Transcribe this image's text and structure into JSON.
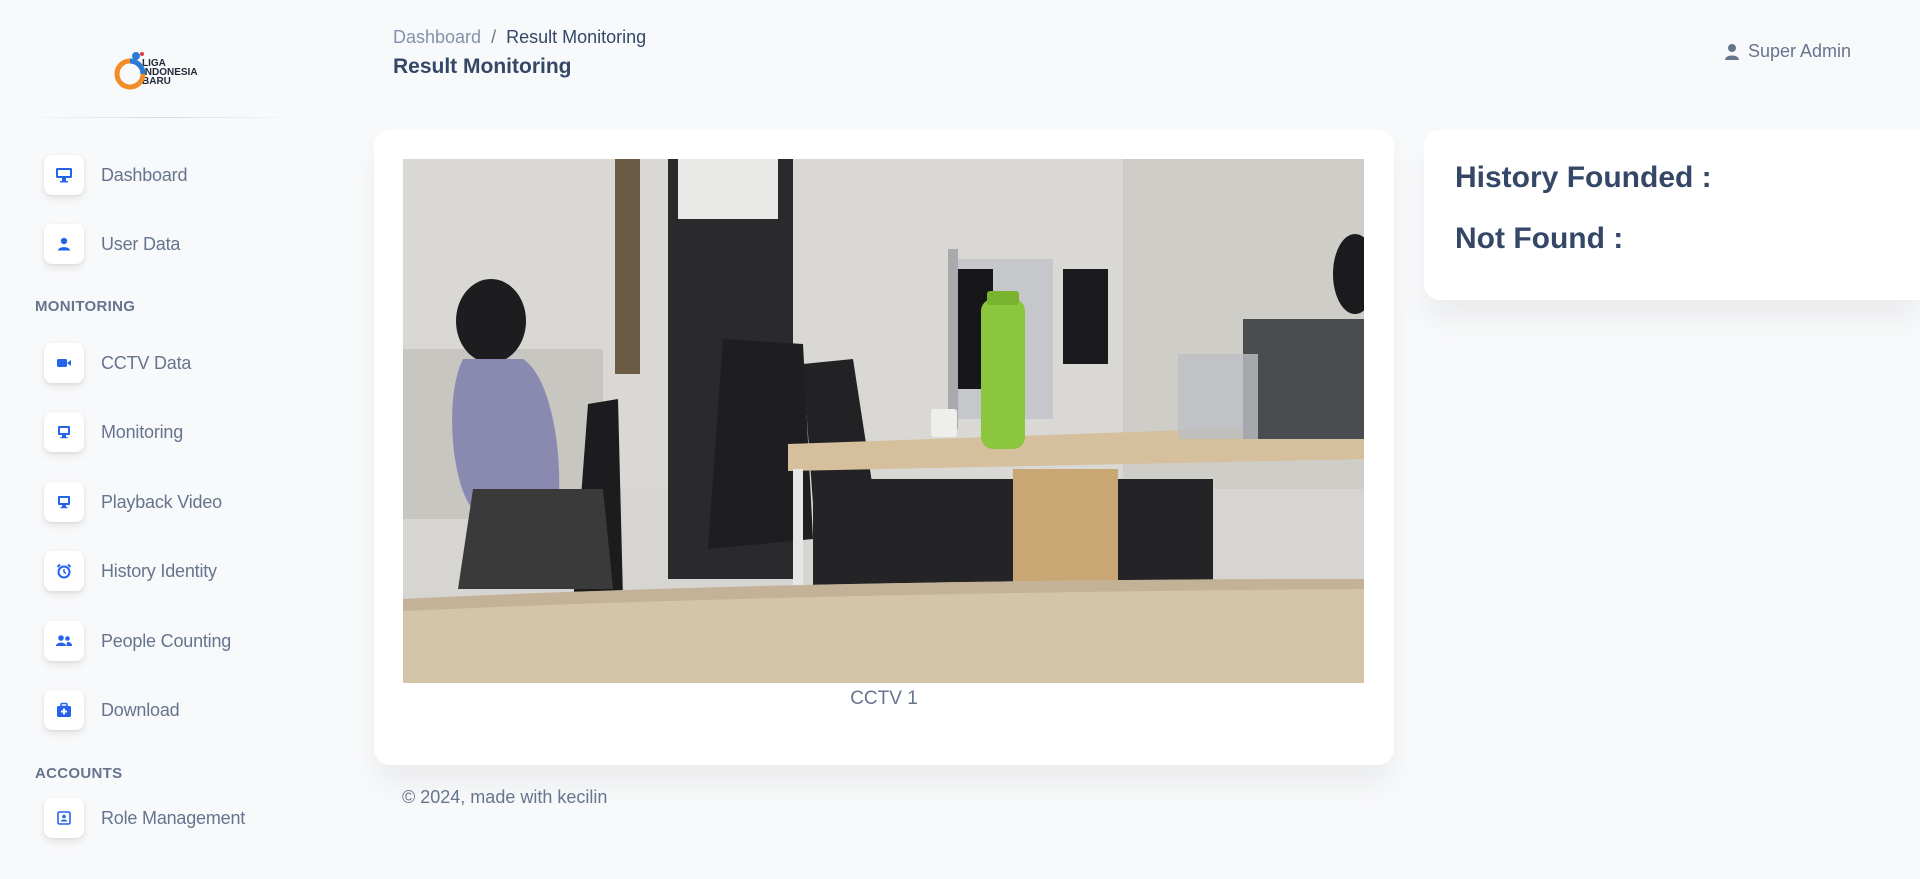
{
  "logo": {
    "lines": [
      "LIGA",
      "INDONESIA",
      "BARU"
    ]
  },
  "sidebar": {
    "items": [
      {
        "label": "Dashboard",
        "icon": "monitor-icon"
      },
      {
        "label": "User Data",
        "icon": "user-icon"
      }
    ],
    "monitoring_heading": "MONITORING",
    "monitoring_items": [
      {
        "label": "CCTV Data",
        "icon": "video-camera-icon"
      },
      {
        "label": "Monitoring",
        "icon": "monitor-icon"
      },
      {
        "label": "Playback Video",
        "icon": "monitor-icon"
      },
      {
        "label": "History Identity",
        "icon": "alarm-clock-icon"
      },
      {
        "label": "People Counting",
        "icon": "users-icon"
      },
      {
        "label": "Download",
        "icon": "briefcase-medical-icon"
      }
    ],
    "accounts_heading": "ACCOUNTS",
    "accounts_items": [
      {
        "label": "Role Management",
        "icon": "id-card-icon"
      }
    ]
  },
  "header": {
    "breadcrumb_parent": "Dashboard",
    "breadcrumb_separator": "/",
    "breadcrumb_current": "Result Monitoring",
    "title": "Result Monitoring",
    "user_name": "Super Admin"
  },
  "main": {
    "camera_label": "CCTV 1"
  },
  "side_panel": {
    "history_founded": "History Founded :",
    "not_found": "Not Found :"
  },
  "footer": {
    "text": "© 2024, made with kecilin"
  },
  "colors": {
    "accent": "#2563eb",
    "text_dark": "#344767",
    "text_muted": "#67748e"
  }
}
